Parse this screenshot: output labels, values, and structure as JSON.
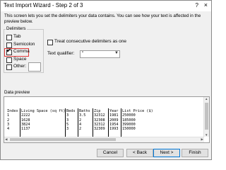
{
  "window": {
    "title": "Text Import Wizard - Step 2 of 3",
    "help_glyph": "?",
    "close_glyph": "×"
  },
  "description": "This screen lets you set the delimiters your data contains. You can see how your text is affected in the preview below.",
  "delimiters": {
    "legend": "Delimiters",
    "items": [
      {
        "label": "Tab",
        "checked": false
      },
      {
        "label": "Semicolon",
        "checked": false
      },
      {
        "label": "Comma",
        "checked": true
      },
      {
        "label": "Space",
        "checked": false
      },
      {
        "label": "Other:",
        "checked": false
      }
    ],
    "other_value": ""
  },
  "options": {
    "consecutive_label": "Treat consecutive delimiters as one",
    "consecutive_checked": false,
    "qualifier_label": "Text qualifier:",
    "qualifier_value": "\""
  },
  "preview": {
    "label": "Data preview",
    "columns": [
      {
        "header": "Index",
        "values": [
          "1",
          "2",
          "3",
          "4"
        ]
      },
      {
        "header": "Living Space (sq ft)",
        "values": [
          "2222",
          "1628",
          "3824",
          "1137"
        ]
      },
      {
        "header": "Beds",
        "values": [
          "3",
          "3",
          "5",
          "3"
        ]
      },
      {
        "header": "Baths",
        "values": [
          "3.5",
          "2",
          "4",
          "2"
        ]
      },
      {
        "header": "Zip",
        "values": [
          "32312",
          "32308",
          "32312",
          "32309"
        ]
      },
      {
        "header": "Year",
        "values": [
          "1981",
          "2009",
          "1954",
          "1993"
        ]
      },
      {
        "header": "List Price ($)",
        "values": [
          "250000",
          "185000",
          "399000",
          "150000"
        ]
      }
    ]
  },
  "buttons": {
    "cancel": "Cancel",
    "back": "< Back",
    "next": "Next >",
    "finish": "Finish"
  },
  "colors": {
    "highlight": "#e03a3a",
    "dialog_bg": "#f0f0f0",
    "default_button_border": "#0078d7"
  }
}
